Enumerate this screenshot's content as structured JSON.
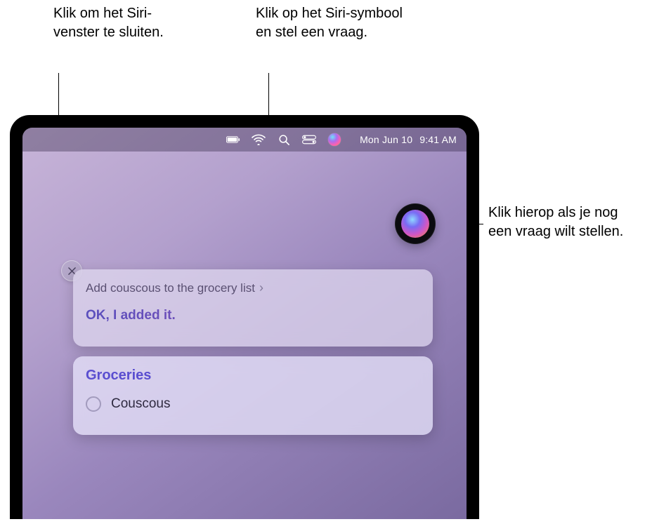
{
  "callouts": {
    "close": "Klik om het Siri-venster te sluiten.",
    "menubar_siri": "Klik op het Siri-symbool en stel een vraag.",
    "orb": "Klik hierop als je nog een vraag wilt stellen."
  },
  "menubar": {
    "date": "Mon Jun 10",
    "time": "9:41 AM"
  },
  "siri": {
    "query": "Add couscous to the grocery list",
    "response": "OK, I added it."
  },
  "reminders": {
    "list_title": "Groceries",
    "items": [
      {
        "label": "Couscous"
      }
    ]
  }
}
